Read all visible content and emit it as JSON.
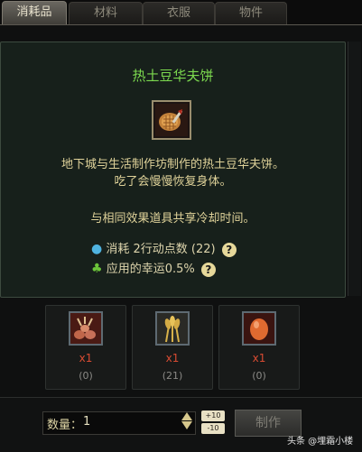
{
  "tabs": [
    "消耗品",
    "材料",
    "衣服",
    "物件"
  ],
  "item": {
    "name": "热土豆华夫饼",
    "description_line1": "地下城与生活制作坊制作的热土豆华夫饼。",
    "description_line2": "吃了会慢慢恢复身体。",
    "cooldown_note": "与相同效果道具共享冷却时间。",
    "cost_label": "消耗 2行动点数 (22)",
    "luck_label": "应用的幸运0.5%",
    "help_glyph": "?"
  },
  "materials": [
    {
      "icon": "bread-items-icon",
      "qty": "x1",
      "have": "(0)"
    },
    {
      "icon": "wheat-icon",
      "qty": "x1",
      "have": "(21)"
    },
    {
      "icon": "egg-icon",
      "qty": "x1",
      "have": "(0)"
    }
  ],
  "quantity": {
    "label": "数量：",
    "value": "1"
  },
  "steppers": {
    "plus": "+10",
    "minus": "-10"
  },
  "craft_button": "制作",
  "watermark": "头条 @埋霜小楼",
  "colors": {
    "title": "#7cd94f",
    "description": "#e0d39a",
    "qty_red": "#d84b32"
  }
}
